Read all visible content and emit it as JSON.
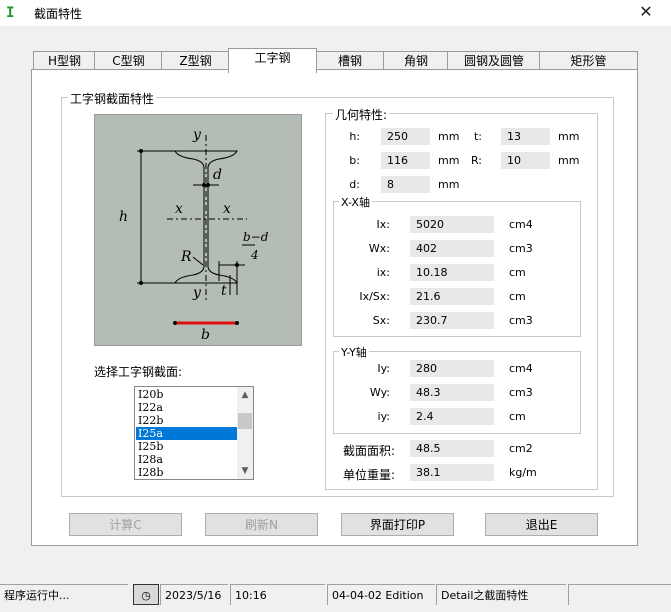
{
  "window": {
    "title": "截面特性",
    "app_icon": "I-beam-icon",
    "close": "✕"
  },
  "tabs": [
    {
      "label": "H型钢",
      "active": false
    },
    {
      "label": "C型钢",
      "active": false
    },
    {
      "label": "Z型钢",
      "active": false
    },
    {
      "label": "工字钢",
      "active": true
    },
    {
      "label": "槽钢",
      "active": false
    },
    {
      "label": "角钢",
      "active": false
    },
    {
      "label": "圆钢及圆管",
      "active": false
    },
    {
      "label": "矩形管",
      "active": false
    }
  ],
  "section_group": {
    "legend": "工字钢截面特性"
  },
  "diagram": {
    "labels": {
      "y_top": "y",
      "y_bottom": "y",
      "x_left": "x",
      "x_right": "x",
      "h": "h",
      "d": "d",
      "R": "R",
      "t": "t",
      "b": "b",
      "bd_top": "b−d",
      "bd_bottom": "4"
    }
  },
  "list": {
    "caption": "选择工字钢截面:",
    "items": [
      "I20b",
      "I22a",
      "I22b",
      "I25a",
      "I25b",
      "I28a",
      "I28b"
    ],
    "selected": "I25a"
  },
  "geometry": {
    "legend": "几何特性:",
    "h": {
      "label": "h:",
      "value": "250",
      "unit": "mm"
    },
    "t": {
      "label": "t:",
      "value": "13",
      "unit": "mm"
    },
    "b": {
      "label": "b:",
      "value": "116",
      "unit": "mm"
    },
    "R": {
      "label": "R:",
      "value": "10",
      "unit": "mm"
    },
    "d": {
      "label": "d:",
      "value": "8",
      "unit": "mm"
    }
  },
  "xx_axis": {
    "legend": "X-X轴",
    "rows": [
      {
        "label": "Ix:",
        "value": "5020",
        "unit": "cm4"
      },
      {
        "label": "Wx:",
        "value": "402",
        "unit": "cm3"
      },
      {
        "label": "ix:",
        "value": "10.18",
        "unit": "cm"
      },
      {
        "label": "Ix/Sx:",
        "value": "21.6",
        "unit": "cm"
      },
      {
        "label": "Sx:",
        "value": "230.7",
        "unit": "cm3"
      }
    ]
  },
  "yy_axis": {
    "legend": "Y-Y轴",
    "rows": [
      {
        "label": "Iy:",
        "value": "280",
        "unit": "cm4"
      },
      {
        "label": "Wy:",
        "value": "48.3",
        "unit": "cm3"
      },
      {
        "label": "iy:",
        "value": "2.4",
        "unit": "cm"
      }
    ]
  },
  "area": {
    "label": "截面面积:",
    "value": "48.5",
    "unit": "cm2"
  },
  "weight": {
    "label": "单位重量:",
    "value": "38.1",
    "unit": "kg/m"
  },
  "buttons": {
    "calc": "计算C",
    "refresh": "刷新N",
    "print": "界面打印P",
    "exit": "退出E"
  },
  "status": {
    "state": "程序运行中...",
    "icon": "clock-icon",
    "date": "2023/5/16",
    "time": "10:16",
    "edition": "04-04-02 Edition",
    "detail": "Detail之截面特性"
  }
}
